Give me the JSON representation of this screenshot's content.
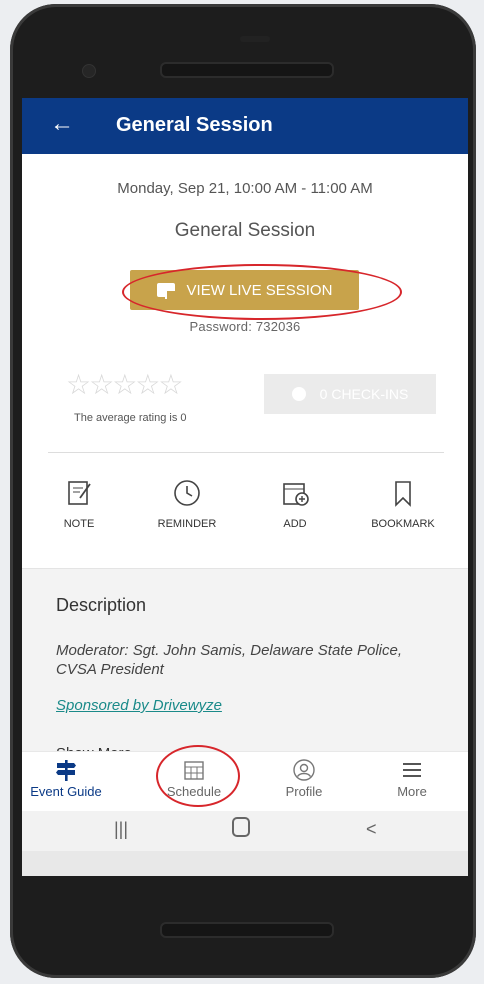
{
  "header": {
    "back_icon": "arrow-left-icon",
    "title": "General Session"
  },
  "session": {
    "date": "Monday, Sep 21, 10:00 AM - 11:00 AM",
    "name": "General Session",
    "live_button": "VIEW LIVE SESSION",
    "password": "Password: 732036",
    "rating_text": "The average rating is 0",
    "checkins": "0 CHECK-INS"
  },
  "actions": [
    {
      "label": "NOTE",
      "icon": "note-icon"
    },
    {
      "label": "REMINDER",
      "icon": "clock-icon"
    },
    {
      "label": "ADD",
      "icon": "calendar-add-icon"
    },
    {
      "label": "BOOKMARK",
      "icon": "bookmark-icon"
    }
  ],
  "description": {
    "title": "Description",
    "text": "Moderator: Sgt. John Samis, Delaware State Police, CVSA President",
    "sponsor": "Sponsored by Drivewyze",
    "show_more": "Show More"
  },
  "tabs": [
    {
      "label": "Event Guide",
      "icon": "signpost-icon",
      "active": true
    },
    {
      "label": "Schedule",
      "icon": "calendar-grid-icon"
    },
    {
      "label": "Profile",
      "icon": "profile-icon"
    },
    {
      "label": "More",
      "icon": "menu-icon"
    }
  ],
  "colors": {
    "appbar": "#0b3a86",
    "accent": "#c8a34b",
    "link": "#1a8a89",
    "annotation": "#d7262b"
  }
}
